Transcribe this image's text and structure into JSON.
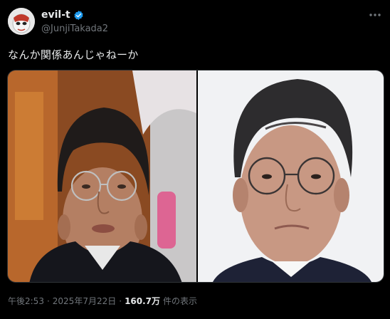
{
  "author": {
    "display_name": "evil-t",
    "handle": "@JunjiTakada2",
    "avatar_icon": "mask-avatar-icon",
    "verified_icon": "verified-badge-icon"
  },
  "tweet": {
    "text": "なんか関係あんじゃねーか"
  },
  "media": {
    "left_photo": "photo-man-glasses-studio",
    "right_photo": "photo-man-glasses-white-background"
  },
  "meta": {
    "time": "午後2:53",
    "separator": "·",
    "date": "2025年7月22日",
    "views": "160.7万",
    "views_label": "件の表示"
  },
  "colors": {
    "background": "#000000",
    "text": "#e7e9ea",
    "muted": "#71767b",
    "verified": "#1d9bf0"
  }
}
